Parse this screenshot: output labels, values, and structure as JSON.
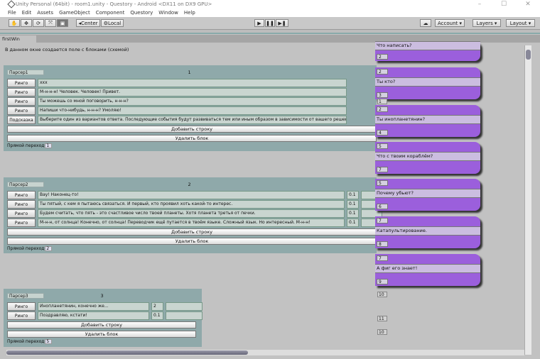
{
  "window": {
    "title": "Unity Personal (64bit) - room1.unity - Questory - Android <DX11 on DX9 GPU>",
    "minimize": "–",
    "maximize": "☐",
    "close": "✕"
  },
  "menu": [
    "File",
    "Edit",
    "Assets",
    "GameObject",
    "Component",
    "Questory",
    "Window",
    "Help"
  ],
  "toolbar": {
    "tools": [
      "✋",
      "✥",
      "⟳",
      "⤧",
      "▣"
    ],
    "center": "◂Center",
    "local": "⚙Local",
    "play": "▶",
    "pause": "❚❚",
    "step": "▶❚",
    "cloud": "☁",
    "account": "Account ▾",
    "layers": "Layers ▾",
    "layout": "Layout ▾"
  },
  "panel": {
    "tab": "firstWin",
    "intro": "В данном окне создается поле с блоками (схемой)",
    "add_row": "Добавить строку",
    "delete_block": "Удалить блок",
    "jump_label": "Прямой переход"
  },
  "blocks": [
    {
      "name": "Парсер1",
      "number": "1",
      "jump": "1",
      "rows": [
        {
          "button": "Ринго",
          "text": "xxx"
        },
        {
          "button": "Ринго",
          "text": "М-н-н-н! Человек. Человек! Привет."
        },
        {
          "button": "Ринго",
          "text": "Ты можешь со мной поговорить, н-н-н?"
        },
        {
          "button": "Ринго",
          "text": "Напиши что-нибудь, н-н-н? Умоляю!"
        },
        {
          "button": "Подсказка",
          "text": "Выберите один из вариантов ответа. Последующие события будут развиваться тем или иным образом в зависимости от вашего решения."
        }
      ]
    },
    {
      "name": "Парсер2",
      "number": "2",
      "jump": "2",
      "rows": [
        {
          "button": "Ринго",
          "text": "Вау! Наконец-то!",
          "value": "0.1",
          "extra": ""
        },
        {
          "button": "Ринго",
          "text": "Ты пятый, с кем я пытаюсь связаться. И первый, кто проявил хоть какой-то интерес.",
          "value": "0.1",
          "extra": ""
        },
        {
          "button": "Ринго",
          "text": "Будем считать, что пять - это счастливое число твоей планеты. Хотя планета третья от печки.",
          "value": "0.1",
          "extra": ""
        },
        {
          "button": "Ринго",
          "text": "М-н-н, от солнца! Конечно, от солнца! Переводчик ещё путается в твоём языке. Сложный язык. Но интересный. М-н-н!",
          "value": "0.1",
          "extra": ""
        }
      ]
    },
    {
      "name": "Парсер3",
      "number": "3",
      "jump": "5",
      "rows": [
        {
          "button": "Ринго",
          "text": "Инопланетянин, конечно же...",
          "value": "2",
          "extra": ""
        },
        {
          "button": "Ринго",
          "text": "Поздравляю, кстати!",
          "value": "0.1",
          "extra": ""
        }
      ]
    }
  ],
  "cards": [
    {
      "in": "",
      "text": "Что написать?",
      "out": "2"
    },
    {
      "in": "2",
      "text": "Ты кто?",
      "out": "3"
    },
    {
      "in": "2",
      "text": "Ты инопланетянин?",
      "out": "4"
    },
    {
      "in": "5",
      "text": "Что с твоим кораблём?",
      "out": "7"
    },
    {
      "in": "5",
      "text": "Почему убьют?",
      "out": "6"
    },
    {
      "in": "7",
      "text": "Катапультирование.",
      "out": "8"
    },
    {
      "in": "7",
      "text": "А фиг его знает!",
      "out": "9"
    }
  ],
  "loose_fields": [
    "1",
    "10",
    "11",
    "10"
  ],
  "colors": {
    "card": "#9b5fdc",
    "block": "#8fa9aa"
  }
}
